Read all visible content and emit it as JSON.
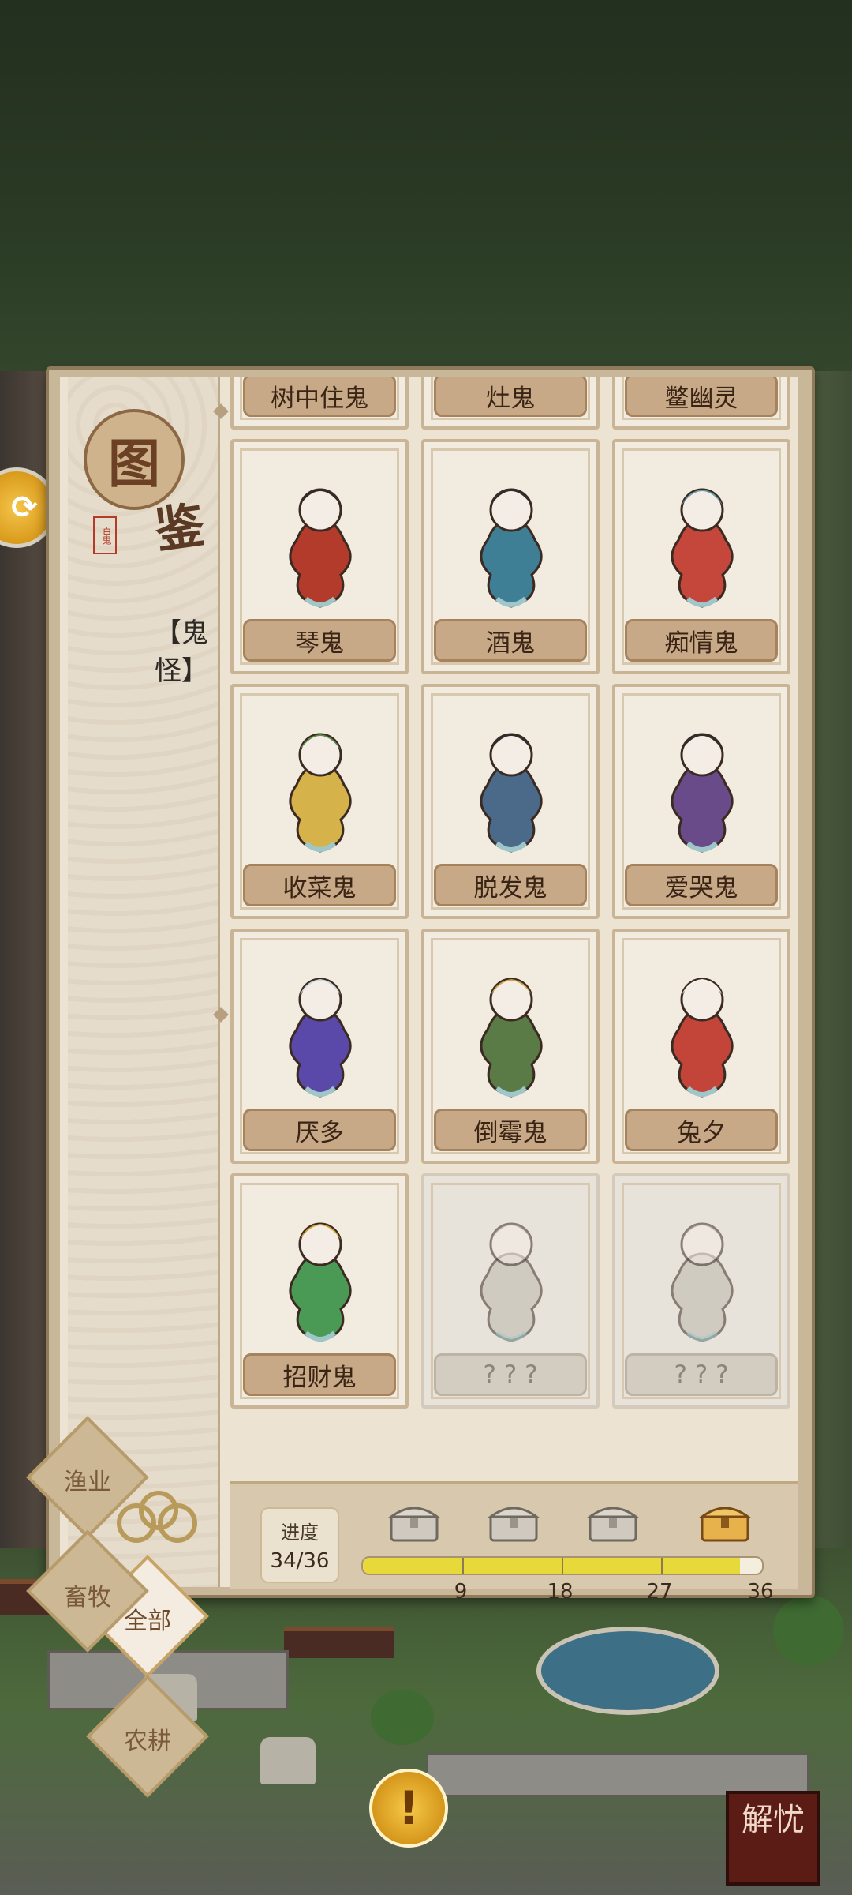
{
  "panel": {
    "title_char_1": "图",
    "title_char_2": "鉴",
    "seal_text": "百鬼",
    "category_title": "【鬼怪】"
  },
  "filters": [
    {
      "label": "全部",
      "active": true
    },
    {
      "label": "农耕",
      "active": false
    },
    {
      "label": "渔业",
      "active": false
    },
    {
      "label": "畜牧",
      "active": false
    }
  ],
  "cards": [
    {
      "name": "树中住鬼",
      "locked": false
    },
    {
      "name": "灶鬼",
      "locked": false
    },
    {
      "name": "鳖幽灵",
      "locked": false
    },
    {
      "name": "琴鬼",
      "locked": false
    },
    {
      "name": "酒鬼",
      "locked": false
    },
    {
      "name": "痴情鬼",
      "locked": false
    },
    {
      "name": "收菜鬼",
      "locked": false
    },
    {
      "name": "脱发鬼",
      "locked": false
    },
    {
      "name": "爱哭鬼",
      "locked": false
    },
    {
      "name": "厌多",
      "locked": false
    },
    {
      "name": "倒霉鬼",
      "locked": false
    },
    {
      "name": "兔夕",
      "locked": false
    },
    {
      "name": "招财鬼",
      "locked": false
    },
    {
      "name": "? ? ?",
      "locked": true
    },
    {
      "name": "? ? ?",
      "locked": true
    }
  ],
  "progress": {
    "label": "进度",
    "value_text": "34/36",
    "current": 34,
    "total": 36,
    "milestones": [
      "9",
      "18",
      "27",
      "36"
    ]
  },
  "buttons": {
    "jieyou_label": "解忧",
    "alert_label": "!"
  },
  "colors": {
    "panel_bg": "#ede3d2",
    "namebar": "#c7a887",
    "progress_fill": "#e8d93b",
    "active_filter": "#f4ece0"
  }
}
